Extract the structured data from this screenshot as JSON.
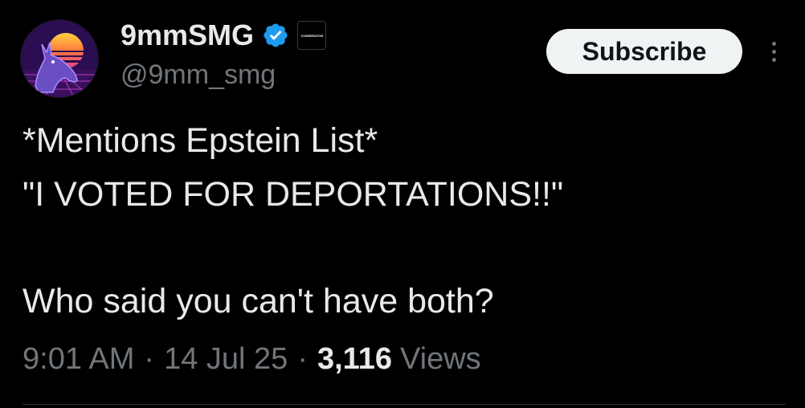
{
  "author": {
    "display_name": "9mmSMG",
    "handle": "@9mm_smg",
    "avatar_icon": "synthwave-donkey-avatar",
    "verified_icon": "verified-badge-icon",
    "affiliate_badge_text": "CONSERVATIVE"
  },
  "actions": {
    "subscribe_label": "Subscribe",
    "more_icon": "more-vertical-icon"
  },
  "tweet": {
    "line1": "*Mentions Epstein List*",
    "line2": "\"I VOTED FOR DEPORTATIONS!!\"",
    "line3": "Who said you can't have both?"
  },
  "meta": {
    "time": "9:01 AM",
    "separator": "·",
    "date": "14 Jul 25",
    "views_count": "3,116",
    "views_label": "Views"
  },
  "colors": {
    "background": "#000000",
    "primary_text": "#e7e9ea",
    "secondary_text": "#71767b",
    "verified_blue": "#1d9bf0",
    "button_bg": "#eff3f4"
  }
}
